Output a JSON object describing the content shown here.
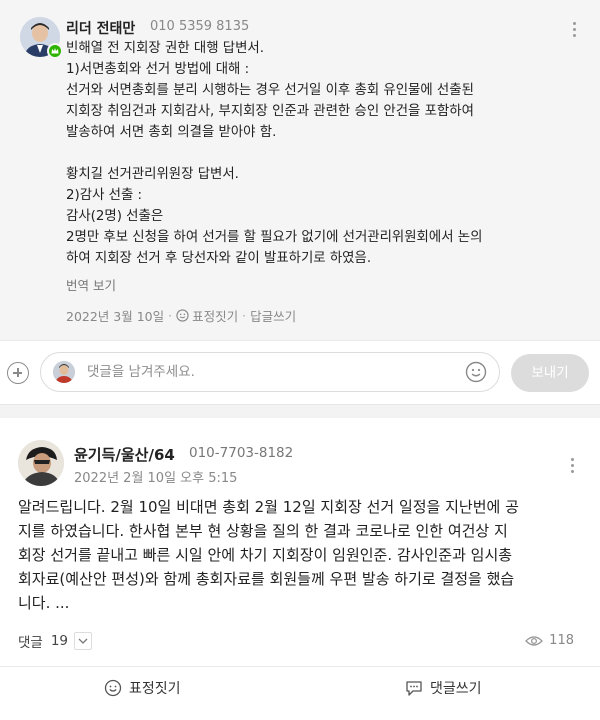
{
  "comment": {
    "author": "리더 전태만",
    "phone": "010 5359 8135",
    "lines": [
      "빈해열 전 지회장 권한 대행 답변서.",
      "1)서면총회와 선거 방법에 대해 :",
      "선거와 서면총회를 분리 시행하는 경우 선거일 이후 총회 유인물에 선출된",
      "지회장 취임건과 지회감사, 부지회장 인준과 관련한 승인 안건을 포함하여",
      "발송하여 서면 총회 의결을 받아야 함.",
      "",
      "황치길 선거관리위원장 답변서.",
      "2)감사 선출 :",
      "감사(2명) 선출은",
      "2명만 후보 신청을 하여 선거를 할 필요가 없기에 선거관리위원회에서 논의",
      "하여 지회장 선거 후 당선자와 같이 발표하기로 하였음."
    ],
    "translate_label": "번역 보기",
    "date": "2022년 3월 10일",
    "emotion_label": "표정짓기",
    "reply_label": "답글쓰기"
  },
  "comment_input": {
    "placeholder": "댓글을 남겨주세요.",
    "value": "",
    "send_label": "보내기"
  },
  "post": {
    "author": "윤기득/울산/64",
    "phone": "010-7703-8182",
    "datetime": "2022년 2월 10일 오후 5:15",
    "lines": [
      "알려드립니다. 2월 10일 비대면 총회 2월 12일 지회장 선거 일정을 지난번에 공",
      "지를 하였습니다. 한사협 본부 현 상황을 질의 한 결과 코로나로 인한 여건상 지",
      "회장 선거를 끝내고 빠른 시일 안에 차기 지회장이 임원인준. 감사인준과 임시총",
      "회자료(예산안 편성)와 함께 총회자료를 회원들께 우편 발송 하기로 결정을 했습",
      "니다. ..."
    ],
    "comment_label": "댓글",
    "comment_count": "19",
    "view_count": "118",
    "emotion_label": "표정짓기",
    "reply_label": "댓글쓰기"
  },
  "colors": {
    "badge_green": "#2db400",
    "send_button_disabled": "#dcdcdc",
    "card_bg": "#f5f5f6"
  },
  "icons": [
    "more-icon",
    "plus-icon",
    "emoji-icon",
    "chevron-down-icon",
    "eye-icon",
    "chat-bubble-icon",
    "crown-badge-icon"
  ]
}
